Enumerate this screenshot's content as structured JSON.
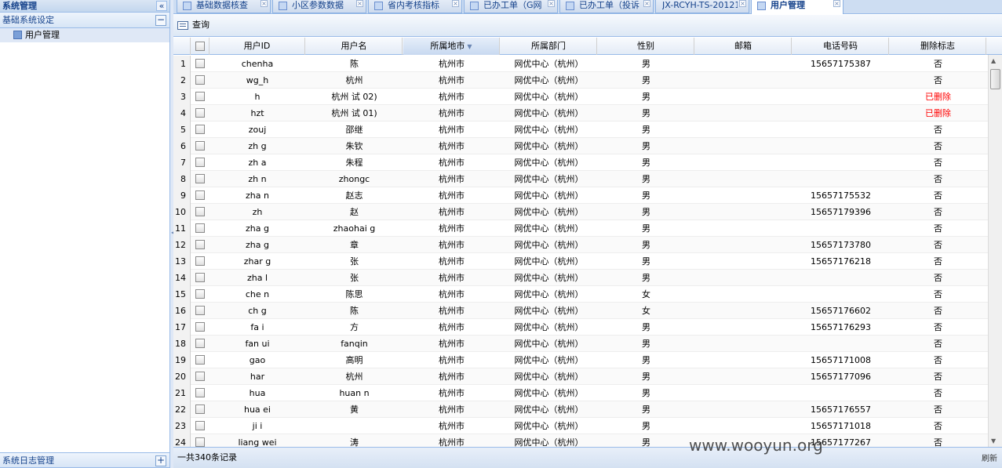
{
  "sidebar": {
    "title": "系统管理",
    "collapse_icon": "«",
    "sections": [
      {
        "title": "基础系统设定",
        "toggle": "−",
        "items": [
          {
            "label": "用户管理"
          }
        ]
      },
      {
        "title": "系统日志管理",
        "toggle": "+"
      }
    ]
  },
  "tabs": [
    {
      "label": "基础数据核查",
      "active": false
    },
    {
      "label": "小区参数数据",
      "active": false
    },
    {
      "label": "省内考核指标",
      "active": false
    },
    {
      "label": "已办工单（G网",
      "active": false
    },
    {
      "label": "已办工单（投诉",
      "active": false
    },
    {
      "label": "JX-RCYH-TS-20121",
      "active": false
    },
    {
      "label": "用户管理",
      "active": true
    }
  ],
  "toolbar": {
    "query_label": "查询"
  },
  "grid": {
    "columns": [
      "用户ID",
      "用户名",
      "所属地市",
      "所属部门",
      "性别",
      "邮箱",
      "电话号码",
      "删除标志"
    ],
    "sorted_column": "所属地市",
    "rows": [
      [
        "1",
        "chenha",
        "陈",
        "杭州市",
        "网优中心（杭州）",
        "男",
        "",
        "15657175387",
        "否"
      ],
      [
        "2",
        "wg_h",
        "杭州",
        "杭州市",
        "网优中心（杭州）",
        "男",
        "",
        "",
        "否"
      ],
      [
        "3",
        "h",
        "杭州 试 02)",
        "杭州市",
        "网优中心（杭州）",
        "男",
        "",
        "",
        "已删除"
      ],
      [
        "4",
        "hzt",
        "杭州 试 01)",
        "杭州市",
        "网优中心（杭州）",
        "男",
        "",
        "",
        "已删除"
      ],
      [
        "5",
        "zouj",
        "邵继",
        "杭州市",
        "网优中心（杭州）",
        "男",
        "",
        "",
        "否"
      ],
      [
        "6",
        "zh g",
        "朱钦",
        "杭州市",
        "网优中心（杭州）",
        "男",
        "",
        "",
        "否"
      ],
      [
        "7",
        "zh a",
        "朱程",
        "杭州市",
        "网优中心（杭州）",
        "男",
        "",
        "",
        "否"
      ],
      [
        "8",
        "zh n",
        "zhongc",
        "杭州市",
        "网优中心（杭州）",
        "男",
        "",
        "",
        "否"
      ],
      [
        "9",
        "zha n",
        "赵志",
        "杭州市",
        "网优中心（杭州）",
        "男",
        "",
        "15657175532",
        "否"
      ],
      [
        "10",
        "zh",
        "赵",
        "杭州市",
        "网优中心（杭州）",
        "男",
        "",
        "15657179396",
        "否"
      ],
      [
        "11",
        "zha g",
        "zhaohai g",
        "杭州市",
        "网优中心（杭州）",
        "男",
        "",
        "",
        "否"
      ],
      [
        "12",
        "zha g",
        "章",
        "杭州市",
        "网优中心（杭州）",
        "男",
        "",
        "15657173780",
        "否"
      ],
      [
        "13",
        "zhar g",
        "张",
        "杭州市",
        "网优中心（杭州）",
        "男",
        "",
        "15657176218",
        "否"
      ],
      [
        "14",
        "zha l",
        "张",
        "杭州市",
        "网优中心（杭州）",
        "男",
        "",
        "",
        "否"
      ],
      [
        "15",
        "che n",
        "陈思",
        "杭州市",
        "网优中心（杭州）",
        "女",
        "",
        "",
        "否"
      ],
      [
        "16",
        "ch g",
        "陈",
        "杭州市",
        "网优中心（杭州）",
        "女",
        "",
        "15657176602",
        "否"
      ],
      [
        "17",
        "fa i",
        "方",
        "杭州市",
        "网优中心（杭州）",
        "男",
        "",
        "15657176293",
        "否"
      ],
      [
        "18",
        "fan ui",
        "fanqin",
        "杭州市",
        "网优中心（杭州）",
        "男",
        "",
        "",
        "否"
      ],
      [
        "19",
        "gao",
        "高明",
        "杭州市",
        "网优中心（杭州）",
        "男",
        "",
        "15657171008",
        "否"
      ],
      [
        "20",
        "har",
        "杭州",
        "杭州市",
        "网优中心（杭州）",
        "男",
        "",
        "15657177096",
        "否"
      ],
      [
        "21",
        "hua",
        "huan n",
        "杭州市",
        "网优中心（杭州）",
        "男",
        "",
        "",
        "否"
      ],
      [
        "22",
        "hua ei",
        "黄",
        "杭州市",
        "网优中心（杭州）",
        "男",
        "",
        "15657176557",
        "否"
      ],
      [
        "23",
        "ji i",
        "",
        "杭州市",
        "网优中心（杭州）",
        "男",
        "",
        "15657171018",
        "否"
      ],
      [
        "24",
        "liang wei",
        "涛",
        "杭州市",
        "网优中心（杭州）",
        "男",
        "",
        "15657177267",
        "否"
      ]
    ]
  },
  "paging": {
    "total_text": "一共340条记录",
    "refresh_label": "刷新"
  },
  "watermark": "www.wooyun.org",
  "colors": {
    "accent": "#15428b",
    "border": "#99bbe8",
    "deleted": "#ff0000"
  }
}
